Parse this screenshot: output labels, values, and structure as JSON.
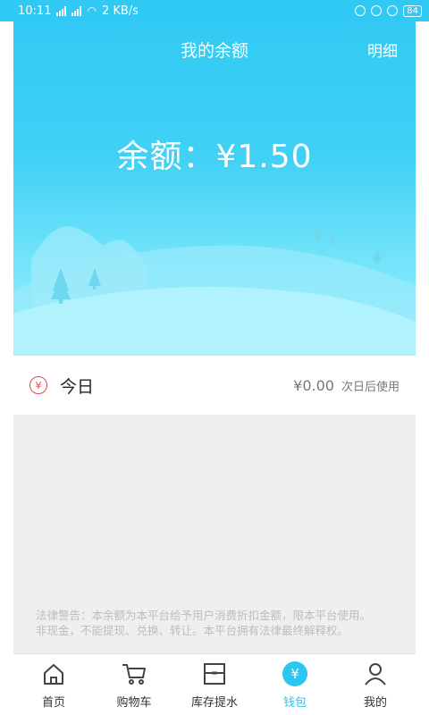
{
  "status_bar": {
    "time": "10:11",
    "speed": "2 KB/s",
    "battery": "84"
  },
  "header": {
    "title": "我的余额",
    "detail_link": "明细"
  },
  "balance": {
    "text": "余额：¥1.50"
  },
  "today": {
    "icon": "yen-icon",
    "label": "今日",
    "amount": "¥0.00",
    "note": "次日后使用"
  },
  "legal_warning": {
    "line1": "法律警告：本余额为本平台给予用户消费折扣金额，限本平台使用。",
    "line2": "非现金，不能提现、兑换、转让。本平台拥有法律最终解释权。"
  },
  "bottom_nav": {
    "items": [
      {
        "label": "首页",
        "icon": "home-icon"
      },
      {
        "label": "购物车",
        "icon": "cart-icon"
      },
      {
        "label": "库存提水",
        "icon": "inventory-icon"
      },
      {
        "label": "钱包",
        "icon": "wallet-icon",
        "active": true
      },
      {
        "label": "我的",
        "icon": "user-icon"
      }
    ]
  },
  "colors": {
    "accent": "#2cc6f2",
    "warning_red": "#e8474a"
  }
}
